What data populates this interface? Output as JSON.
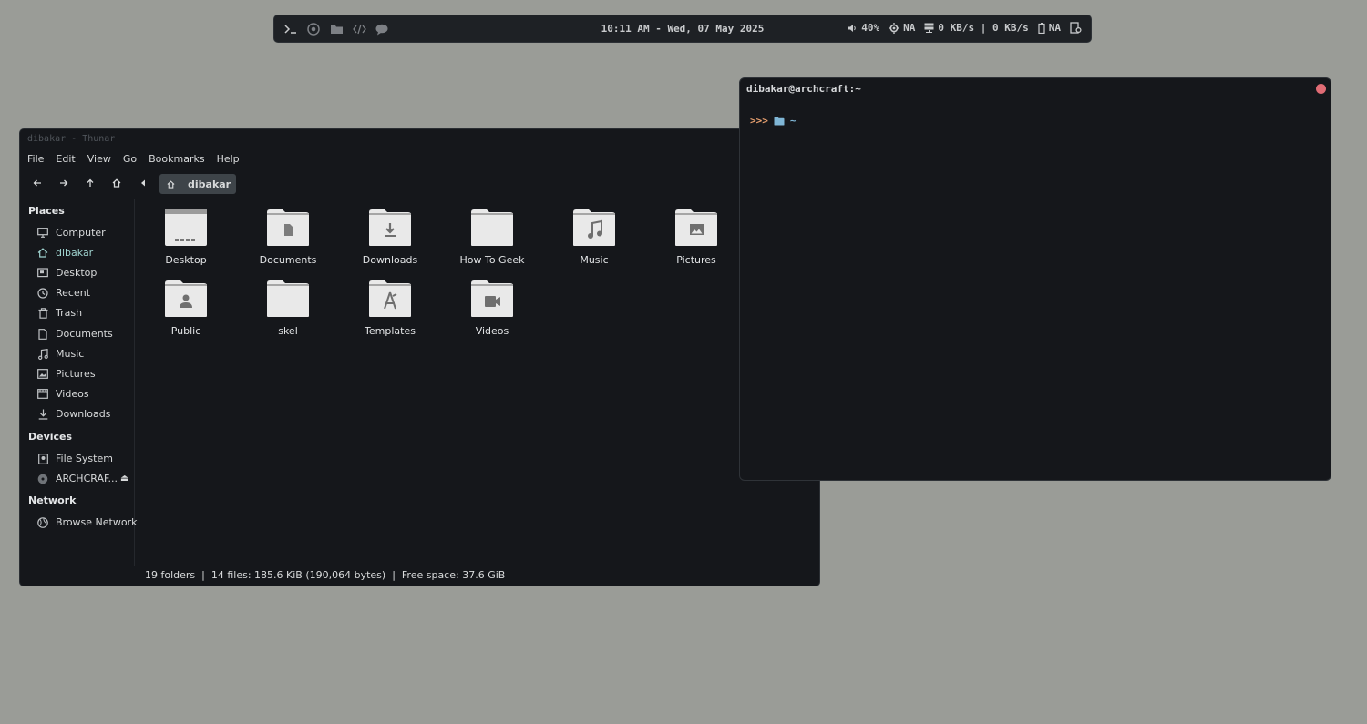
{
  "topbar": {
    "launchers": [
      "terminal-icon",
      "browser-icon",
      "file-manager-icon",
      "code-editor-icon",
      "chat-icon"
    ],
    "clock": "10:11 AM - Wed, 07 May 2025",
    "volume": "40%",
    "brightness": "NA",
    "network": "0 KB/s | 0 KB/s",
    "battery": "NA"
  },
  "thunar": {
    "title": "dibakar - Thunar",
    "menu": [
      "File",
      "Edit",
      "View",
      "Go",
      "Bookmarks",
      "Help"
    ],
    "breadcrumb": "dibakar",
    "sidebar": {
      "places_heading": "Places",
      "places": [
        "Computer",
        "dibakar",
        "Desktop",
        "Recent",
        "Trash",
        "Documents",
        "Music",
        "Pictures",
        "Videos",
        "Downloads"
      ],
      "devices_heading": "Devices",
      "devices": [
        "File System",
        "ARCHCRAF..."
      ],
      "network_heading": "Network",
      "network": [
        "Browse Network"
      ]
    },
    "folders": [
      "Desktop",
      "Documents",
      "Downloads",
      "How To Geek",
      "Music",
      "Pictures",
      "Public",
      "skel",
      "Templates",
      "Videos"
    ],
    "status": "19 folders  |  14 files: 185.6 KiB (190,064 bytes)  |  Free space: 37.6 GiB"
  },
  "terminal": {
    "title": "dibakar@archcraft:~",
    "prompt_symbol": ">>>",
    "prompt_path": "~"
  },
  "colors": {
    "desktop_bg": "#9a9c97",
    "window_bg": "#15171b",
    "accent": "#9fd3cf",
    "close_button": "#e06c75"
  }
}
